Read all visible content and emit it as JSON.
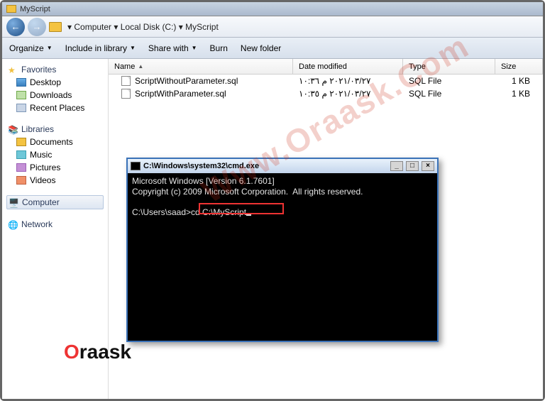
{
  "window": {
    "title": "MyScript"
  },
  "breadcrumb": {
    "parts": [
      "Computer",
      "Local Disk (C:)",
      "MyScript"
    ]
  },
  "toolbar": {
    "organize": "Organize",
    "include": "Include in library",
    "share": "Share with",
    "burn": "Burn",
    "newfolder": "New folder"
  },
  "sidebar": {
    "favorites": {
      "label": "Favorites",
      "items": [
        {
          "label": "Desktop"
        },
        {
          "label": "Downloads"
        },
        {
          "label": "Recent Places"
        }
      ]
    },
    "libraries": {
      "label": "Libraries",
      "items": [
        {
          "label": "Documents"
        },
        {
          "label": "Music"
        },
        {
          "label": "Pictures"
        },
        {
          "label": "Videos"
        }
      ]
    },
    "computer": {
      "label": "Computer"
    },
    "network": {
      "label": "Network"
    }
  },
  "columns": {
    "name": "Name",
    "date": "Date modified",
    "type": "Type",
    "size": "Size"
  },
  "files": [
    {
      "name": "ScriptWithoutParameter.sql",
      "date": "٢٠٢١/٠٣/٢٧ م ١٠:٣٦",
      "type": "SQL File",
      "size": "1 KB"
    },
    {
      "name": "ScriptWithParameter.sql",
      "date": "٢٠٢١/٠٣/٢٧ م ١٠:٣٥",
      "type": "SQL File",
      "size": "1 KB"
    }
  ],
  "cmd": {
    "title": "C:\\Windows\\system32\\cmd.exe",
    "line1": "Microsoft Windows [Version 6.1.7601]",
    "line2": "Copyright (c) 2009 Microsoft Corporation.  All rights reserved.",
    "prompt": "C:\\Users\\saad>",
    "typed": "cd C:\\MyScript"
  },
  "watermark": "Www.Oraask.Com",
  "brand": {
    "o": "O",
    "rest": "raask"
  }
}
